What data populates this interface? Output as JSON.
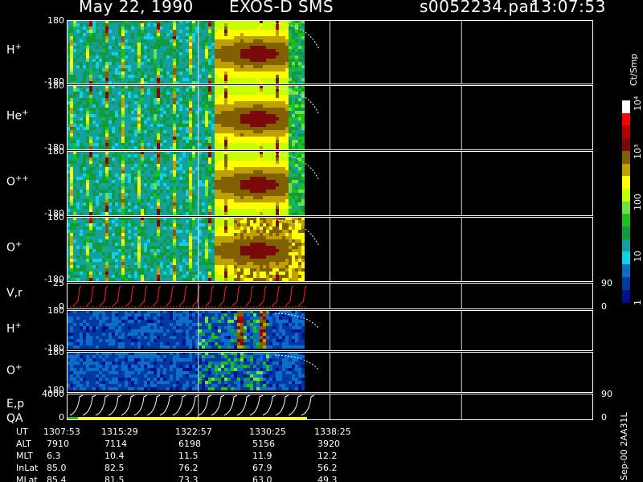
{
  "header": {
    "date": "May 22, 1990",
    "instrument": "EXOS-D SMS",
    "file": "s0052234.par",
    "time": "13:07:53"
  },
  "panels": [
    {
      "label": "H",
      "sup": "+",
      "top": "180",
      "bottom": "-180",
      "kind": "spectro",
      "style": "mass"
    },
    {
      "label": "He",
      "sup": "+",
      "top": "180",
      "bottom": "-180",
      "kind": "spectro",
      "style": "mass"
    },
    {
      "label": "O",
      "sup": "++",
      "top": "180",
      "bottom": "-180",
      "kind": "spectro",
      "style": "mass"
    },
    {
      "label": "O",
      "sup": "+",
      "top": "180",
      "bottom": "-180",
      "kind": "spectro",
      "style": "mass"
    },
    {
      "label": "V,r",
      "sup": "",
      "top": "25",
      "bottom": "0",
      "right_top": "90",
      "right_bottom": "0",
      "kind": "line"
    },
    {
      "label": "H",
      "sup": "+",
      "top": "180",
      "bottom": "-180",
      "kind": "spectro",
      "style": "dim"
    },
    {
      "label": "O",
      "sup": "+",
      "top": "180",
      "bottom": "-180",
      "kind": "spectro",
      "style": "dim"
    },
    {
      "label": "E,p",
      "label2": "QA",
      "sup": "",
      "top": "4000",
      "bottom": "0",
      "right_top": "90",
      "right_bottom": "0",
      "kind": "energy"
    }
  ],
  "colorbar": {
    "unit": "Ct/Smp",
    "ticks": [
      "10⁴",
      "10³",
      "100",
      "10",
      "1"
    ],
    "colors": [
      "#ffffff",
      "#ff0000",
      "#b40000",
      "#7a0a0a",
      "#806000",
      "#bfa000",
      "#ffff00",
      "#c8ff00",
      "#6ee04a",
      "#1cc21c",
      "#129a3c",
      "#14a0a0",
      "#12d0e8",
      "#0a6ec8",
      "#003aa0",
      "#00108a"
    ]
  },
  "table": {
    "headers": [
      "UT",
      "ALT",
      "MLT",
      "InLat",
      "MLat"
    ],
    "columns": [
      [
        "1307:53",
        "7910",
        "6.3",
        "85.0",
        "85.4"
      ],
      [
        "1315:29",
        "7114",
        "10.4",
        "82.5",
        "81.5"
      ],
      [
        "1322:57",
        "6198",
        "11.5",
        "76.2",
        "73.3"
      ],
      [
        "1330:25",
        "5156",
        "11.9",
        "67.9",
        "63.0"
      ],
      [
        "1338:25",
        "3920",
        "12.2",
        "56.2",
        "49.3"
      ]
    ]
  },
  "footer_note": "Sep-00 2AA31L",
  "chart_data": {
    "type": "heatmap",
    "title": "May 22, 1990 EXOS-D SMS",
    "x_ticks": [
      "1307:53",
      "1315:29",
      "1322:57",
      "1330:25",
      "1338:25"
    ],
    "data_end_fraction": 0.457,
    "series": [
      {
        "name": "H+",
        "ylim": [
          -180,
          180
        ]
      },
      {
        "name": "He+",
        "ylim": [
          -180,
          180
        ]
      },
      {
        "name": "O++",
        "ylim": [
          -180,
          180
        ]
      },
      {
        "name": "O+",
        "ylim": [
          -180,
          180
        ]
      },
      {
        "name": "V,r",
        "ylim": [
          0,
          25
        ],
        "right_ylim": [
          0,
          90
        ]
      },
      {
        "name": "H+",
        "ylim": [
          -180,
          180
        ]
      },
      {
        "name": "O+",
        "ylim": [
          -180,
          180
        ]
      },
      {
        "name": "E,p",
        "ylim": [
          0,
          4000
        ],
        "right_ylim": [
          0,
          90
        ]
      }
    ],
    "colorbar_unit": "Ct/Smp",
    "colorbar_scale": "log",
    "colorbar_range": [
      1,
      10000
    ]
  }
}
